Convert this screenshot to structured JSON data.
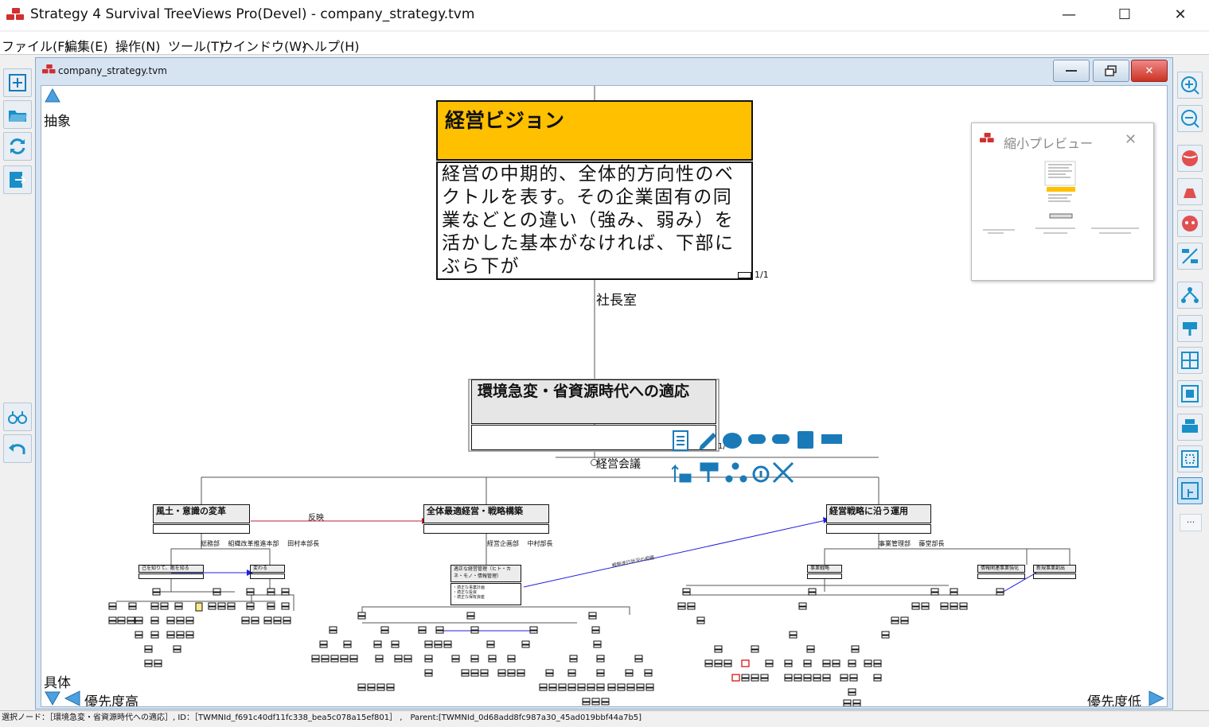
{
  "window": {
    "title": "Strategy 4 Survival TreeViews Pro(Devel) - company_strategy.tvm",
    "minimize": "—",
    "maximize": "☐",
    "close": "✕"
  },
  "menu": [
    "ファイル(F)",
    "編集(E)",
    "操作(N)",
    "ツール(T)",
    "ウインドウ(W)",
    "ヘルプ(H)"
  ],
  "document": {
    "tab_title": "company_strategy.tvm"
  },
  "axis": {
    "top_label": "抽象",
    "bottom_label": "具体",
    "left_priority": "優先度高",
    "right_priority": "優先度低"
  },
  "vision_node": {
    "title": "経営ビジョン",
    "body": "経営の中期的、全体的方向性のベクトルを表す。その企業固有の同業などとの違い（強み、弱み）を活かした基本がなければ、下部にぶら下が",
    "page": "1/1",
    "owner": "社長室"
  },
  "env_node": {
    "title": "環境急変・省資源時代への適応",
    "page": "1/",
    "owner": "経営会議"
  },
  "level2": [
    {
      "title": "風土・意識の変革",
      "owner": "総務部　 組織改革推進本部　 田村本部長"
    },
    {
      "title": "全体最適経営・戦略構築",
      "owner": "経営企画部　 中村部長"
    },
    {
      "title": "経営戦略に沿う運用",
      "owner": "事業管理部　 藤堂部長"
    }
  ],
  "relations": {
    "reflect": "反映",
    "strategy_link": "戦略遂行状況の把握"
  },
  "level3": [
    {
      "title": "己を知りて、敵を知る"
    },
    {
      "title": "変わる"
    },
    {
      "title": "適正な経営管理（ヒト・カネ・モノ・情報管理）",
      "body": "・適正な事業計画\n・適正な投資\n・適正な保有資産"
    },
    {
      "title": "事業戦略"
    },
    {
      "title": "情報関連事業強化"
    },
    {
      "title": "新規事業創出"
    }
  ],
  "preview": {
    "title": "縮小プレビュー",
    "close": "✕"
  },
  "toolbar_more": "...",
  "status": "選択ノード：［環境急変・省資源時代への適応］, ID：［TWMNId_f691c40df11fc338_bea5c078a15ef801］ ,　Parent:[TWMNId_0d68add8fc987a30_45ad019bbf44a7b5]",
  "colors": {
    "vision_title_bg": "#ffc000",
    "accent_blue": "#3a8fd0",
    "link_blue": "#2020e0",
    "link_red": "#c00020"
  }
}
